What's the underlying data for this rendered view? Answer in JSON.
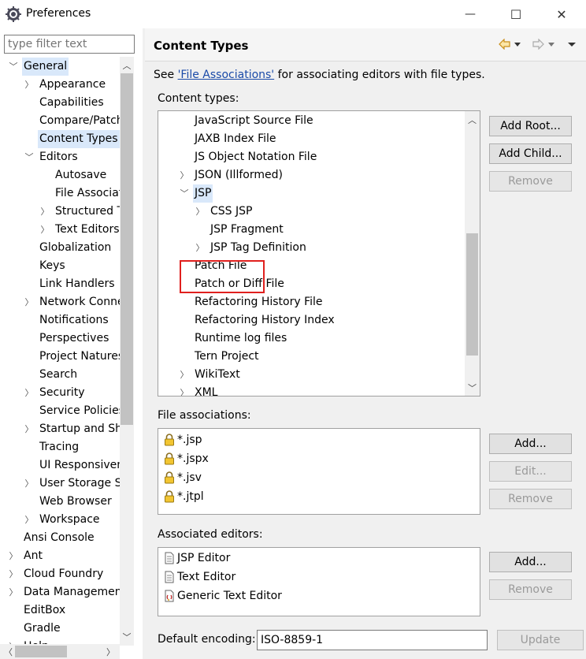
{
  "window": {
    "title": "Preferences",
    "min_glyph": "—",
    "max_glyph": "☐",
    "close_glyph": "✕"
  },
  "filter": {
    "placeholder": "type filter text"
  },
  "left_tree": [
    {
      "label": "General",
      "level": 0,
      "expander": "expanded",
      "selected_parent": true
    },
    {
      "label": "Appearance",
      "level": 1,
      "expander": "collapsed"
    },
    {
      "label": "Capabilities",
      "level": 1,
      "expander": "none"
    },
    {
      "label": "Compare/Patch",
      "level": 1,
      "expander": "none"
    },
    {
      "label": "Content Types",
      "level": 1,
      "expander": "none",
      "selected": true
    },
    {
      "label": "Editors",
      "level": 1,
      "expander": "expanded"
    },
    {
      "label": "Autosave",
      "level": 2,
      "expander": "none"
    },
    {
      "label": "File Associations",
      "level": 2,
      "expander": "none"
    },
    {
      "label": "Structured Text Editors",
      "level": 2,
      "expander": "collapsed"
    },
    {
      "label": "Text Editors",
      "level": 2,
      "expander": "collapsed"
    },
    {
      "label": "Globalization",
      "level": 1,
      "expander": "none"
    },
    {
      "label": "Keys",
      "level": 1,
      "expander": "none"
    },
    {
      "label": "Link Handlers",
      "level": 1,
      "expander": "none"
    },
    {
      "label": "Network Connections",
      "level": 1,
      "expander": "collapsed"
    },
    {
      "label": "Notifications",
      "level": 1,
      "expander": "none"
    },
    {
      "label": "Perspectives",
      "level": 1,
      "expander": "none"
    },
    {
      "label": "Project Natures",
      "level": 1,
      "expander": "none"
    },
    {
      "label": "Search",
      "level": 1,
      "expander": "none"
    },
    {
      "label": "Security",
      "level": 1,
      "expander": "collapsed"
    },
    {
      "label": "Service Policies",
      "level": 1,
      "expander": "none"
    },
    {
      "label": "Startup and Shutdown",
      "level": 1,
      "expander": "collapsed"
    },
    {
      "label": "Tracing",
      "level": 1,
      "expander": "none"
    },
    {
      "label": "UI Responsiveness",
      "level": 1,
      "expander": "none"
    },
    {
      "label": "User Storage Service",
      "level": 1,
      "expander": "collapsed"
    },
    {
      "label": "Web Browser",
      "level": 1,
      "expander": "none"
    },
    {
      "label": "Workspace",
      "level": 1,
      "expander": "collapsed"
    },
    {
      "label": "Ansi Console",
      "level": 0,
      "expander": "none"
    },
    {
      "label": "Ant",
      "level": 0,
      "expander": "collapsed"
    },
    {
      "label": "Cloud Foundry",
      "level": 0,
      "expander": "collapsed"
    },
    {
      "label": "Data Management",
      "level": 0,
      "expander": "collapsed"
    },
    {
      "label": "EditBox",
      "level": 0,
      "expander": "none"
    },
    {
      "label": "Gradle",
      "level": 0,
      "expander": "none"
    },
    {
      "label": "Help",
      "level": 0,
      "expander": "collapsed"
    }
  ],
  "page": {
    "title": "Content Types",
    "see_prefix": "See ",
    "see_link": "'File Associations'",
    "see_suffix": " for associating editors with file types.",
    "content_types_label": "Content types:",
    "file_assoc_label": "File associations:",
    "assoc_editors_label": "Associated editors:",
    "default_encoding_label": "Default encoding:",
    "default_encoding_value": "ISO-8859-1"
  },
  "content_types": [
    {
      "label": "JavaScript Source File",
      "level": 0,
      "expander": "none"
    },
    {
      "label": "JAXB Index File",
      "level": 0,
      "expander": "none"
    },
    {
      "label": "JS Object Notation File",
      "level": 0,
      "expander": "none"
    },
    {
      "label": "JSON (Illformed)",
      "level": 0,
      "expander": "collapsed"
    },
    {
      "label": "JSP",
      "level": 0,
      "expander": "expanded",
      "selected": true
    },
    {
      "label": "CSS JSP",
      "level": 1,
      "expander": "collapsed"
    },
    {
      "label": "JSP Fragment",
      "level": 1,
      "expander": "none"
    },
    {
      "label": "JSP Tag Definition",
      "level": 1,
      "expander": "collapsed"
    },
    {
      "label": "Patch File",
      "level": 0,
      "expander": "none"
    },
    {
      "label": "Patch or Diff File",
      "level": 0,
      "expander": "none"
    },
    {
      "label": "Refactoring History File",
      "level": 0,
      "expander": "none"
    },
    {
      "label": "Refactoring History Index",
      "level": 0,
      "expander": "none"
    },
    {
      "label": "Runtime log files",
      "level": 0,
      "expander": "none"
    },
    {
      "label": "Tern Project",
      "level": 0,
      "expander": "none"
    },
    {
      "label": "WikiText",
      "level": 0,
      "expander": "collapsed"
    },
    {
      "label": "XML",
      "level": 0,
      "expander": "collapsed"
    }
  ],
  "file_associations": [
    "*.jsp",
    "*.jspx",
    "*.jsv",
    "*.jtpl"
  ],
  "associated_editors": [
    {
      "label": "JSP Editor",
      "icon": "jsp-editor-icon"
    },
    {
      "label": "Text Editor",
      "icon": "text-editor-icon"
    },
    {
      "label": "Generic Text Editor",
      "icon": "generic-editor-icon"
    }
  ],
  "buttons": {
    "add_root": "Add Root...",
    "add_child": "Add Child...",
    "remove_ct": "Remove",
    "add_fa": "Add...",
    "edit_fa": "Edit...",
    "remove_fa": "Remove",
    "add_ae": "Add...",
    "remove_ae": "Remove",
    "update": "Update"
  },
  "colors": {
    "selection": "#d9e8fa",
    "highlight_box": "#e0201e",
    "link": "#1a4aa8",
    "back_arrow": "#c98e1a"
  }
}
